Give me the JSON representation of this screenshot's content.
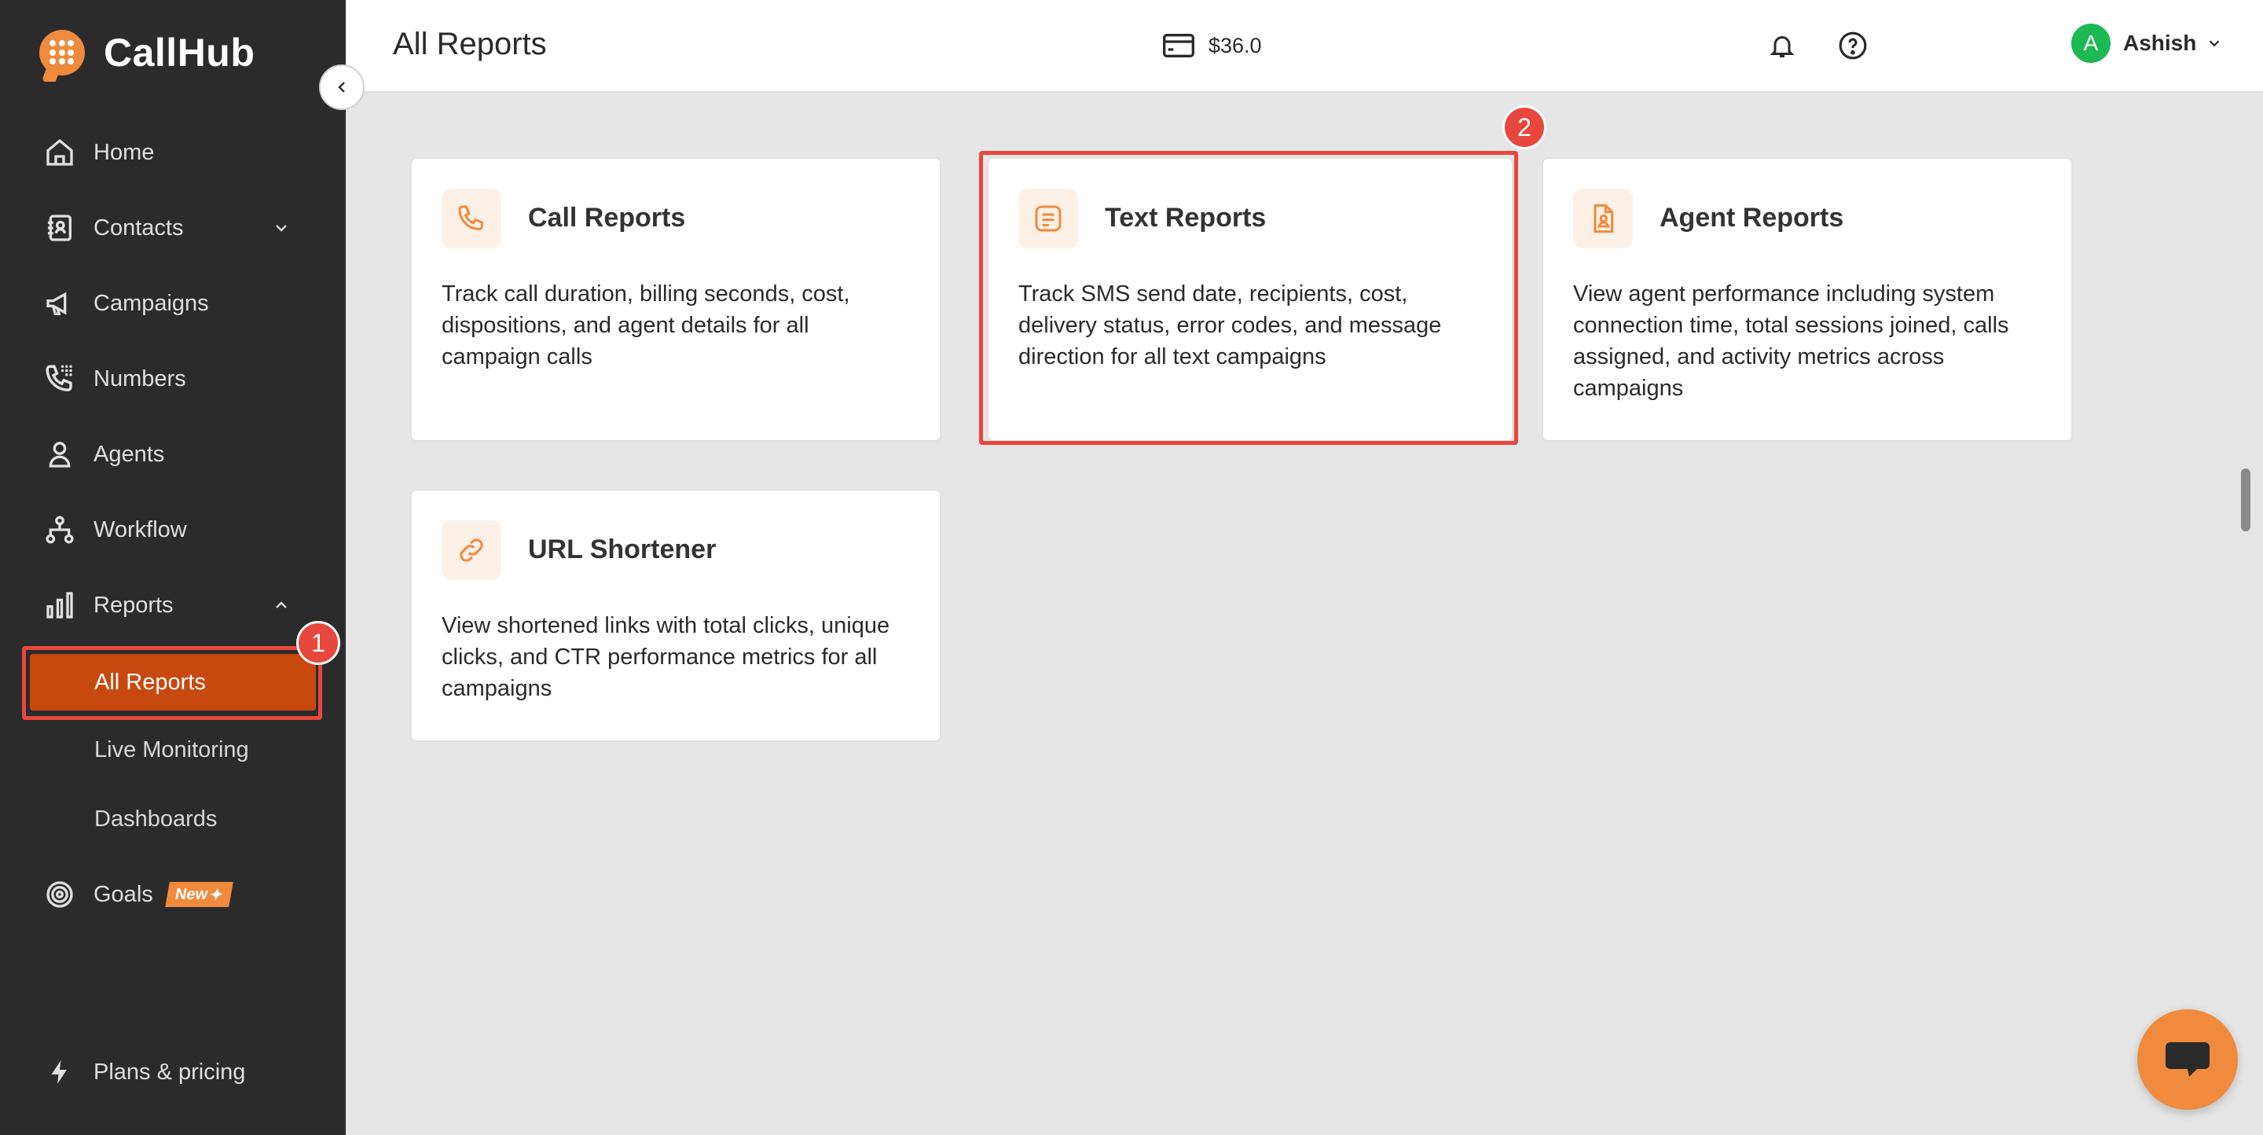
{
  "brand": {
    "name": "CallHub"
  },
  "sidebar": {
    "items": [
      {
        "label": "Home",
        "icon": "home-icon"
      },
      {
        "label": "Contacts",
        "icon": "contacts-icon"
      },
      {
        "label": "Campaigns",
        "icon": "megaphone-icon"
      },
      {
        "label": "Numbers",
        "icon": "phone-keypad-icon"
      },
      {
        "label": "Agents",
        "icon": "person-icon"
      },
      {
        "label": "Workflow",
        "icon": "workflow-icon"
      },
      {
        "label": "Reports",
        "icon": "bar-chart-icon"
      },
      {
        "label": "Goals",
        "icon": "target-icon",
        "tag": "New"
      },
      {
        "label": "Plans & pricing",
        "icon": "lightning-icon"
      }
    ],
    "reports_sub": [
      {
        "label": "All Reports",
        "active": true
      },
      {
        "label": "Live Monitoring"
      },
      {
        "label": "Dashboards"
      }
    ]
  },
  "header": {
    "title": "All Reports",
    "balance": "$36.0",
    "user": {
      "initial": "A",
      "name": "Ashish"
    }
  },
  "cards": [
    {
      "title": "Call Reports",
      "icon": "phone-icon",
      "desc": "Track call duration, billing seconds, cost, dispositions, and agent details for all campaign calls"
    },
    {
      "title": "Text Reports",
      "icon": "message-icon",
      "desc": "Track SMS send date, recipients, cost, delivery status, error codes, and message direction for all text campaigns"
    },
    {
      "title": "Agent Reports",
      "icon": "agent-file-icon",
      "desc": "View agent performance including system connection time, total sessions joined, calls assigned, and activity metrics across campaigns"
    },
    {
      "title": "URL Shortener",
      "icon": "link-icon",
      "desc": "View shortened links with total clicks, unique clicks, and CTR performance metrics for all campaigns"
    }
  ],
  "annotations": {
    "step1": "1",
    "step2": "2"
  },
  "colors": {
    "accent": "#f08a3c",
    "active": "#c8490f",
    "highlight": "#e8473d",
    "sidebar": "#2b2b2b"
  }
}
